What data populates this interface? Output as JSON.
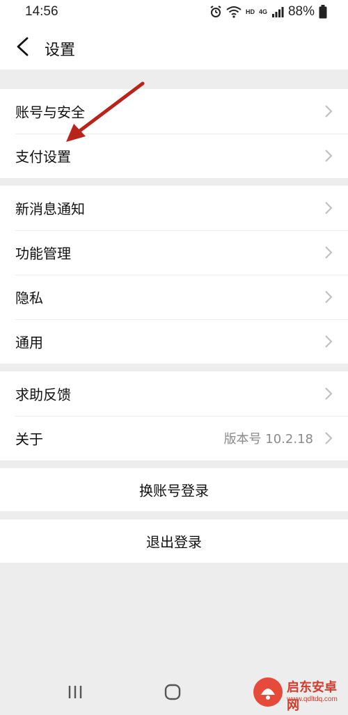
{
  "status_bar": {
    "time": "14:56",
    "network_label": "HD",
    "signal_label": "4G",
    "battery": "88%"
  },
  "header": {
    "title": "设置"
  },
  "groups": [
    {
      "items": [
        {
          "label": "账号与安全"
        },
        {
          "label": "支付设置"
        }
      ]
    },
    {
      "items": [
        {
          "label": "新消息通知"
        },
        {
          "label": "功能管理"
        },
        {
          "label": "隐私"
        },
        {
          "label": "通用"
        }
      ]
    },
    {
      "items": [
        {
          "label": "求助反馈"
        },
        {
          "label": "关于",
          "value": "版本号 10.2.18"
        }
      ]
    }
  ],
  "actions": {
    "switch_account": "换账号登录",
    "logout": "退出登录"
  },
  "nav": {
    "icons": [
      "recent-apps-icon",
      "home-icon",
      "back-icon"
    ]
  },
  "watermark": {
    "brand": "启东安卓网",
    "url": "www.qdltdq.com"
  },
  "colors": {
    "background": "#ededed",
    "card": "#ffffff",
    "annotation_arrow": "#b8241c",
    "watermark": "#d33b2c"
  }
}
